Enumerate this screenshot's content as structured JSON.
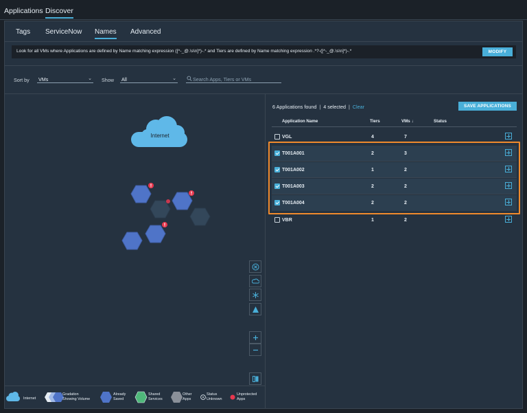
{
  "top_tabs": [
    {
      "label": "Applications",
      "active": false
    },
    {
      "label": "Discover",
      "active": true
    }
  ],
  "sub_tabs": [
    {
      "label": "Tags",
      "active": false
    },
    {
      "label": "ServiceNow",
      "active": false
    },
    {
      "label": "Names",
      "active": true
    },
    {
      "label": "Advanced",
      "active": false
    }
  ],
  "expression": {
    "text": "Look for all VMs where Applications are defined by Name matching expression ([^-_@.\\s\\n]*)-.* and Tiers are defined by Name matching expression .*?-([^-_@.\\s\\n]*)-.*",
    "modify_label": "MODIFY"
  },
  "filters": {
    "sort_label": "Sort by",
    "sort_value": "VMs",
    "show_label": "Show",
    "show_value": "All",
    "search_placeholder": "Search Apps, Tiers or VMs"
  },
  "topology": {
    "internet_label": "Internet",
    "tool_icons": [
      "close-circle-icon",
      "cloud-icon",
      "snowflake-icon",
      "warning-triangle-icon"
    ],
    "zoom_in": "+",
    "zoom_out": "−"
  },
  "legend": {
    "internet": "Internet",
    "gradation": "Gradation\nShowing Volume",
    "already_saved": "Already\nSaved",
    "shared_services": "Shared\nServices",
    "other_apps": "Other\nApps",
    "status_unknown": "Status\nUnknown",
    "unprotected_apps": "Unprotected\nApps"
  },
  "results": {
    "found_text": "6 Applications found",
    "selected_text": "4 selected",
    "clear_label": "Clear",
    "save_label": "SAVE APPLICATIONS"
  },
  "table": {
    "headers": {
      "name": "Application Name",
      "tiers": "Tiers",
      "vms": "VMs ↓",
      "status": "Status"
    },
    "rows": [
      {
        "name": "VGL",
        "tiers": "4",
        "vms": "7",
        "checked": false
      },
      {
        "name": "T001A001",
        "tiers": "2",
        "vms": "3",
        "checked": true
      },
      {
        "name": "T001A002",
        "tiers": "1",
        "vms": "2",
        "checked": true
      },
      {
        "name": "T001A003",
        "tiers": "2",
        "vms": "2",
        "checked": true
      },
      {
        "name": "T001A004",
        "tiers": "2",
        "vms": "2",
        "checked": true
      },
      {
        "name": "VBR",
        "tiers": "1",
        "vms": "2",
        "checked": false
      }
    ]
  },
  "colors": {
    "accent": "#49afd9",
    "highlight": "#f08a2c",
    "panel": "#253240",
    "background": "#1b2128",
    "saved_hex": "#4f74c8",
    "alert": "#e8384f"
  }
}
